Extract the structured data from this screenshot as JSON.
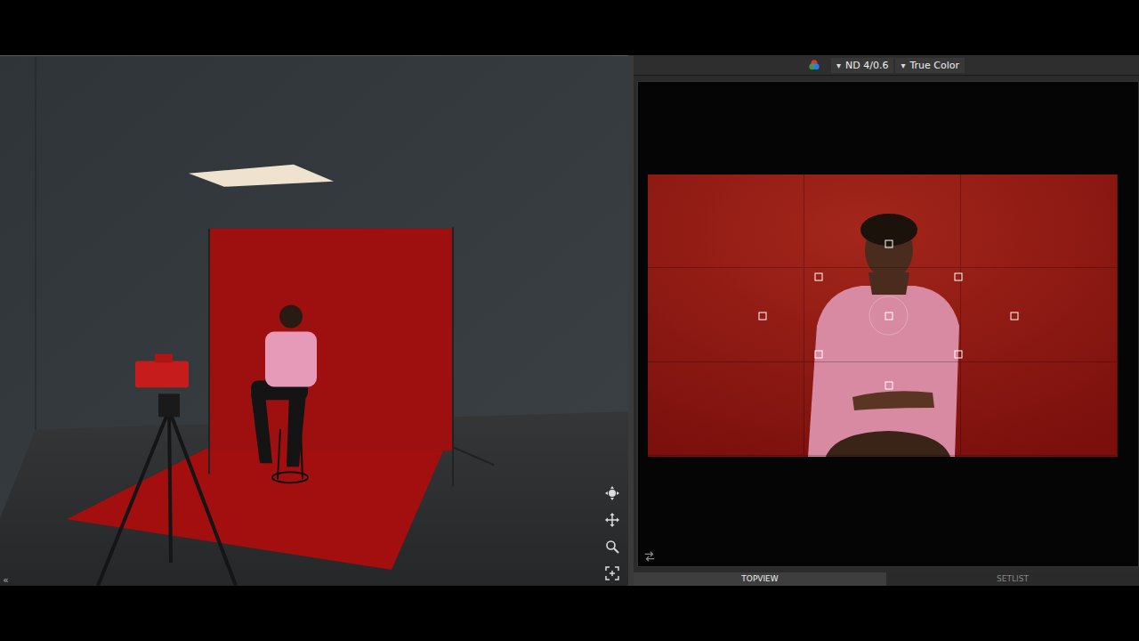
{
  "viewport": {
    "collapse": "«"
  },
  "toolbar": {
    "filter": {
      "arrow": "▾",
      "label": "ND 4/0.6"
    },
    "color_mode": {
      "arrow": "▾",
      "label": "True Color"
    }
  },
  "preview": {
    "grid": true,
    "focus_points": [
      {
        "selected": false
      },
      {
        "selected": false
      },
      {
        "selected": false
      },
      {
        "selected": false
      },
      {
        "selected": true
      },
      {
        "selected": false
      },
      {
        "selected": false
      },
      {
        "selected": false
      },
      {
        "selected": false
      }
    ]
  },
  "tabs": [
    {
      "label": "TOPVIEW",
      "selected": true
    },
    {
      "label": "SETLIST",
      "selected": false
    }
  ]
}
